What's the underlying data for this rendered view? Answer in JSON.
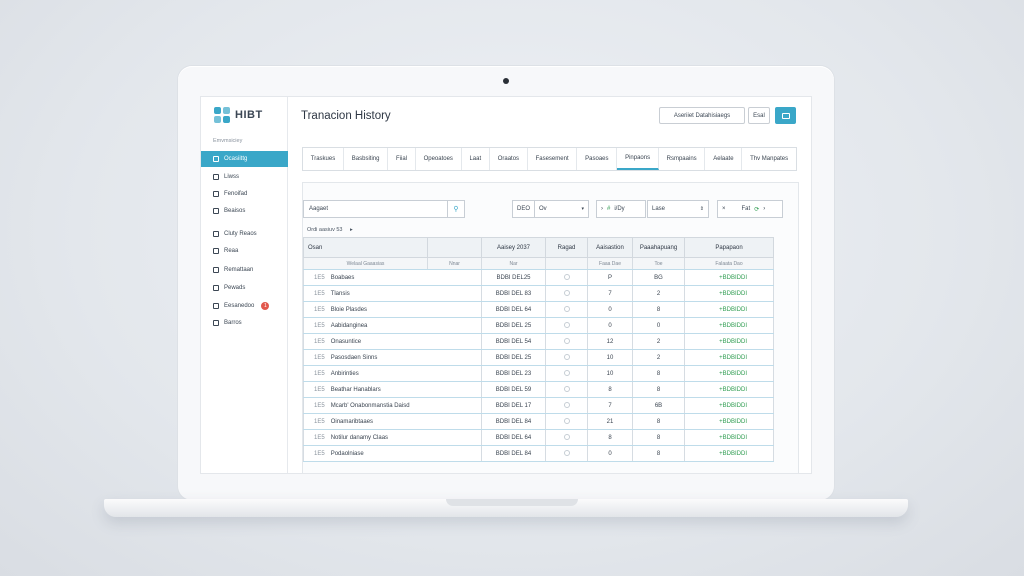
{
  "app": {
    "logo_text": "HIBT",
    "page_title": "Tranacion History"
  },
  "sidebar": {
    "section_label": "Emvmsiciey",
    "items": [
      {
        "label": "Ocasiittg",
        "icon": "dashboard-icon",
        "active": true
      },
      {
        "label": "Liwss",
        "icon": "list-icon"
      },
      {
        "label": "Fenoifad",
        "icon": "document-icon"
      },
      {
        "label": "Beaisos",
        "icon": "chart-icon"
      },
      {
        "label": "Cluty Reaos",
        "icon": "wallet-icon"
      },
      {
        "label": "Reaa",
        "icon": "user-icon"
      },
      {
        "label": "Remattaan",
        "icon": "transfer-icon"
      },
      {
        "label": "Pewads",
        "icon": "report-icon"
      },
      {
        "label": "Eesanedoo",
        "icon": "bell-icon",
        "badge": "1"
      },
      {
        "label": "Barros",
        "icon": "settings-icon"
      }
    ]
  },
  "header": {
    "export_label": "Aseriiet Datahisiaegs",
    "small_label": "Esal"
  },
  "tabs": [
    "Traskues",
    "Basbsiting",
    "Fiial",
    "Opeoatoes",
    "Laat",
    "Oraatos",
    "Fasesement",
    "Pasoaes",
    "Pinpaons",
    "Rsmpaains",
    "Aelaate",
    "Thv Manpates"
  ],
  "filters": {
    "search_placeholder": "Aagaet",
    "f1_label": "DEO",
    "f1_value": "Ov",
    "f2_label": "#",
    "f2_value": "i/Dy",
    "f3_value": "Lase",
    "f4_label": "Fat"
  },
  "table": {
    "group_label": "Ordi aasiuv 53",
    "columns": [
      "Osan",
      "",
      "Aaisey 2037",
      "Ragad",
      "Aaisastion",
      "Paaahapuang",
      "Papapaon"
    ],
    "subheader": [
      "Welaal Gaaasias",
      "Nnar",
      "Nar",
      "",
      "Faaa Dae",
      "Toe",
      "Falaata Dao"
    ],
    "rows": [
      {
        "id": "1E5",
        "name": "Boabaes",
        "date": "BDBI DEL25",
        "qty": "P",
        "rank": "BG",
        "amount": "+BDBIDDI"
      },
      {
        "id": "1E5",
        "name": "Tlansis",
        "date": "BDBI DEL 83",
        "qty": "7",
        "rank": "2",
        "amount": "+BDBIDDI"
      },
      {
        "id": "1E5",
        "name": "Bloie Plasdes",
        "date": "BDBI DEL 64",
        "qty": "0",
        "rank": "8",
        "amount": "+BDBIDDI"
      },
      {
        "id": "1E5",
        "name": "Aabidanginea",
        "date": "BDBI DEL 25",
        "qty": "0",
        "rank": "0",
        "amount": "+BDBIDDI"
      },
      {
        "id": "1E5",
        "name": "Onasuntice",
        "date": "BDBI DEL 54",
        "qty": "12",
        "rank": "2",
        "amount": "+BDBIDDI"
      },
      {
        "id": "1E5",
        "name": "Pasosdaen Sinns",
        "date": "BDBI DEL 25",
        "qty": "10",
        "rank": "2",
        "amount": "+BDBIDDI"
      },
      {
        "id": "1E5",
        "name": "Anbirinties",
        "date": "BDBI DEL 23",
        "qty": "10",
        "rank": "8",
        "amount": "+BDBIDDI"
      },
      {
        "id": "1E5",
        "name": "Beathar Hanablars",
        "date": "BDBI DEL 59",
        "qty": "8",
        "rank": "8",
        "amount": "+BDBIDDI"
      },
      {
        "id": "1E5",
        "name": "Mcarb' Onabonmanstia Daisd",
        "date": "BDBI DEL 17",
        "qty": "7",
        "rank": "6B",
        "amount": "+BDBIDDI"
      },
      {
        "id": "1E5",
        "name": "Oinamaribtaaes",
        "date": "BDBI DEL 84",
        "qty": "21",
        "rank": "8",
        "amount": "+BDBIDDI"
      },
      {
        "id": "1E5",
        "name": "Notilur danamy Claas",
        "date": "BDBI DEL 64",
        "qty": "8",
        "rank": "8",
        "amount": "+BDBIDDI"
      },
      {
        "id": "1E5",
        "name": "Podaolniase",
        "date": "BDBI DEL 84",
        "qty": "0",
        "rank": "8",
        "amount": "+BDBIDDI"
      }
    ]
  },
  "colors": {
    "accent": "#3aa7c8",
    "amount_green": "#2e9c50",
    "badge_red": "#e2574c"
  }
}
